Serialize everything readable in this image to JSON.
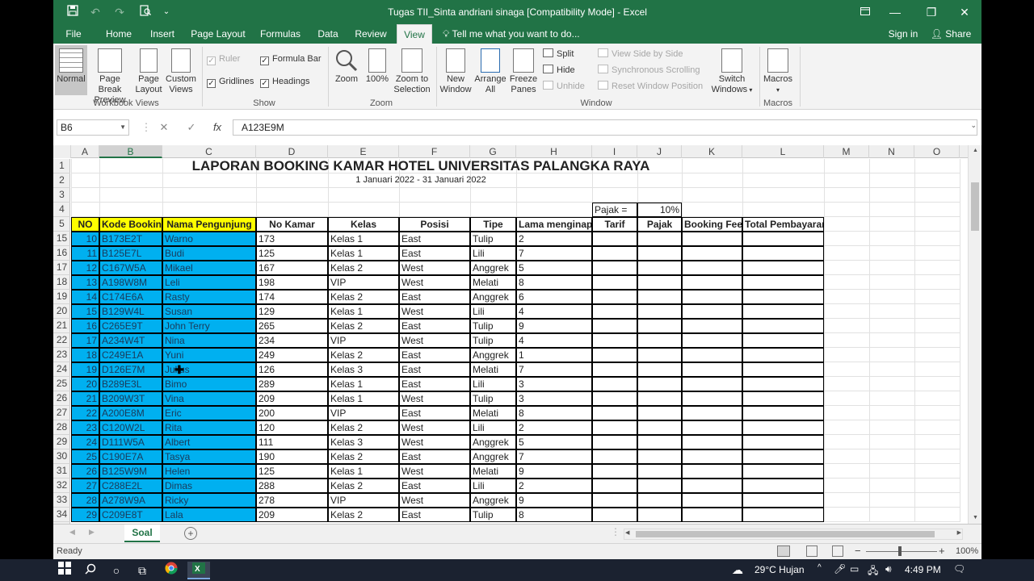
{
  "window": {
    "title": "Tugas TII_Sinta andriani sinaga  [Compatibility Mode] - Excel",
    "save_icon": "save-icon",
    "undo_icon": "undo-icon",
    "redo_icon": "redo-icon",
    "preview_icon": "print-preview-icon",
    "customize_icon": "customize-qat-icon",
    "ribbon_opts_icon": "ribbon-display-options-icon",
    "minimize": "—",
    "restore": "❐",
    "close": "✕"
  },
  "tabs": [
    "File",
    "Home",
    "Insert",
    "Page Layout",
    "Formulas",
    "Data",
    "Review",
    "View"
  ],
  "active_tab": "View",
  "tell_me": "Tell me what you want to do...",
  "sign_in": "Sign in",
  "share": "Share",
  "ribbon": {
    "workbook_views": {
      "label": "Workbook Views",
      "normal": "Normal",
      "page_break_1": "Page Break",
      "page_break_2": "Preview",
      "page_layout_1": "Page",
      "page_layout_2": "Layout",
      "custom_views_1": "Custom",
      "custom_views_2": "Views"
    },
    "show": {
      "label": "Show",
      "ruler": "Ruler",
      "formula_bar": "Formula Bar",
      "gridlines": "Gridlines",
      "headings": "Headings"
    },
    "zoom": {
      "label": "Zoom",
      "zoom": "Zoom",
      "zoom100": "100%",
      "zoom_sel_1": "Zoom to",
      "zoom_sel_2": "Selection"
    },
    "window": {
      "label": "Window",
      "new_window_1": "New",
      "new_window_2": "Window",
      "arrange_1": "Arrange",
      "arrange_2": "All",
      "freeze_1": "Freeze",
      "freeze_2": "Panes",
      "split": "Split",
      "hide": "Hide",
      "unhide": "Unhide",
      "side_by_side": "View Side by Side",
      "sync_scroll": "Synchronous Scrolling",
      "reset_pos": "Reset Window Position",
      "switch_1": "Switch",
      "switch_2": "Windows"
    },
    "macros": {
      "label": "Macros",
      "macros": "Macros"
    }
  },
  "formula_bar": {
    "name_box": "B6",
    "cancel": "✕",
    "enter": "✓",
    "fx": "fx",
    "content": "A123E9M"
  },
  "columns": [
    "A",
    "B",
    "C",
    "D",
    "E",
    "F",
    "G",
    "H",
    "I",
    "J",
    "K",
    "L",
    "M",
    "N",
    "O"
  ],
  "sheet": {
    "title": "LAPORAN BOOKING KAMAR HOTEL UNIVERSITAS PALANGKA RAYA",
    "subtitle": "1 Januari 2022 - 31 Januari 2022",
    "pajak_label": "Pajak =",
    "pajak_value": "10%",
    "headers": [
      "NO",
      "Kode Booking",
      "Nama Pengunjung",
      "No Kamar",
      "Kelas",
      "Posisi",
      "Tipe",
      "Lama menginap",
      "Tarif",
      "Pajak",
      "Booking Fee",
      "Total Pembayaran"
    ],
    "top_row_numbers": [
      "1",
      "2",
      "3",
      "4",
      "5"
    ],
    "rows": [
      {
        "r": "15",
        "no": "10",
        "kode": "B173E2T",
        "nama": "Warno",
        "kamar": "173",
        "kelas": "Kelas 1",
        "posisi": "East",
        "tipe": "Tulip",
        "lama": "2"
      },
      {
        "r": "16",
        "no": "11",
        "kode": "B125E7L",
        "nama": "Budi",
        "kamar": "125",
        "kelas": "Kelas 1",
        "posisi": "East",
        "tipe": "Lili",
        "lama": "7"
      },
      {
        "r": "17",
        "no": "12",
        "kode": "C167W5A",
        "nama": "Mikael",
        "kamar": "167",
        "kelas": "Kelas 2",
        "posisi": "West",
        "tipe": "Anggrek",
        "lama": "5"
      },
      {
        "r": "18",
        "no": "13",
        "kode": "A198W8M",
        "nama": "Leli",
        "kamar": "198",
        "kelas": "VIP",
        "posisi": "West",
        "tipe": "Melati",
        "lama": "8"
      },
      {
        "r": "19",
        "no": "14",
        "kode": "C174E6A",
        "nama": "Rasty",
        "kamar": "174",
        "kelas": "Kelas 2",
        "posisi": "East",
        "tipe": "Anggrek",
        "lama": "6"
      },
      {
        "r": "20",
        "no": "15",
        "kode": "B129W4L",
        "nama": "Susan",
        "kamar": "129",
        "kelas": "Kelas 1",
        "posisi": "West",
        "tipe": "Lili",
        "lama": "4"
      },
      {
        "r": "21",
        "no": "16",
        "kode": "C265E9T",
        "nama": "John Terry",
        "kamar": "265",
        "kelas": "Kelas 2",
        "posisi": "East",
        "tipe": "Tulip",
        "lama": "9"
      },
      {
        "r": "22",
        "no": "17",
        "kode": "A234W4T",
        "nama": "Nina",
        "kamar": "234",
        "kelas": "VIP",
        "posisi": "West",
        "tipe": "Tulip",
        "lama": "4"
      },
      {
        "r": "23",
        "no": "18",
        "kode": "C249E1A",
        "nama": "Yuni",
        "kamar": "249",
        "kelas": "Kelas 2",
        "posisi": "East",
        "tipe": "Anggrek",
        "lama": "1"
      },
      {
        "r": "24",
        "no": "19",
        "kode": "D126E7M",
        "nama": "Julius",
        "kamar": "126",
        "kelas": "Kelas 3",
        "posisi": "East",
        "tipe": "Melati",
        "lama": "7"
      },
      {
        "r": "25",
        "no": "20",
        "kode": "B289E3L",
        "nama": "Bimo",
        "kamar": "289",
        "kelas": "Kelas 1",
        "posisi": "East",
        "tipe": "Lili",
        "lama": "3"
      },
      {
        "r": "26",
        "no": "21",
        "kode": "B209W3T",
        "nama": "Vina",
        "kamar": "209",
        "kelas": "Kelas 1",
        "posisi": "West",
        "tipe": "Tulip",
        "lama": "3"
      },
      {
        "r": "27",
        "no": "22",
        "kode": "A200E8M",
        "nama": "Eric",
        "kamar": "200",
        "kelas": "VIP",
        "posisi": "East",
        "tipe": "Melati",
        "lama": "8"
      },
      {
        "r": "28",
        "no": "23",
        "kode": "C120W2L",
        "nama": "Rita",
        "kamar": "120",
        "kelas": "Kelas 2",
        "posisi": "West",
        "tipe": "Lili",
        "lama": "2"
      },
      {
        "r": "29",
        "no": "24",
        "kode": "D111W5A",
        "nama": "Albert",
        "kamar": "111",
        "kelas": "Kelas 3",
        "posisi": "West",
        "tipe": "Anggrek",
        "lama": "5"
      },
      {
        "r": "30",
        "no": "25",
        "kode": "C190E7A",
        "nama": "Tasya",
        "kamar": "190",
        "kelas": "Kelas 2",
        "posisi": "East",
        "tipe": "Anggrek",
        "lama": "7"
      },
      {
        "r": "31",
        "no": "26",
        "kode": "B125W9M",
        "nama": "Helen",
        "kamar": "125",
        "kelas": "Kelas 1",
        "posisi": "West",
        "tipe": "Melati",
        "lama": "9"
      },
      {
        "r": "32",
        "no": "27",
        "kode": "C288E2L",
        "nama": "Dimas",
        "kamar": "288",
        "kelas": "Kelas 2",
        "posisi": "East",
        "tipe": "Lili",
        "lama": "2"
      },
      {
        "r": "33",
        "no": "28",
        "kode": "A278W9A",
        "nama": "Ricky",
        "kamar": "278",
        "kelas": "VIP",
        "posisi": "West",
        "tipe": "Anggrek",
        "lama": "9"
      },
      {
        "r": "34",
        "no": "29",
        "kode": "C209E8T",
        "nama": "Lala",
        "kamar": "209",
        "kelas": "Kelas 2",
        "posisi": "East",
        "tipe": "Tulip",
        "lama": "8"
      }
    ]
  },
  "sheet_tabs": [
    "Soal"
  ],
  "add_sheet": "+",
  "status": {
    "ready": "Ready",
    "zoom": "100%",
    "minus": "−",
    "plus": "+"
  },
  "taskbar": {
    "weather": "29°C  Hujan",
    "time": "4:49 PM",
    "chevron": "^"
  },
  "colors": {
    "excel_green": "#217346",
    "header_yellow": "#ffff00",
    "data_blue": "#00b0f0"
  }
}
